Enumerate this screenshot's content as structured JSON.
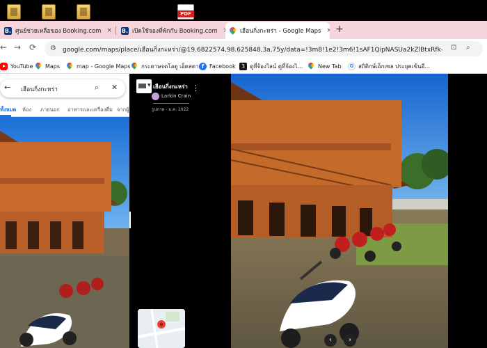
{
  "browser": {
    "tabs": [
      {
        "label": "ศูนย์ช่วยเหลือของ Booking.com",
        "favicon": "booking-icon",
        "active": false
      },
      {
        "label": "เปิดใช้จองที่พักกับ Booking.com",
        "favicon": "booking-icon",
        "active": false
      },
      {
        "label": "เฮือนกิ่งกะหร่า - Google Maps",
        "favicon": "google-maps-icon",
        "active": true
      }
    ],
    "new_tab": "+",
    "tab_close": "×",
    "url": "google.com/maps/place/เฮือนกิ่งกะหร่า/@19.6822574,98.625848,3a,75y/data=!3m8!1e2!3m6!1sAF1QipNASUa2kZlBtxRfk-QRSP3sxFptT3uc...",
    "bookmarks": [
      {
        "label": "YouTube",
        "icon": "youtube-icon"
      },
      {
        "label": "Maps",
        "icon": "maps-icon"
      },
      {
        "label": "map - Google Maps",
        "icon": "maps-icon"
      },
      {
        "label": "กระดาษจดโอตู เอ็ดสตา...",
        "icon": "maps-icon"
      },
      {
        "label": "Facebook",
        "icon": "facebook-icon"
      },
      {
        "label": "ดูที่จ้องไลน์ ดูที่จ้องไ...",
        "icon": "site-3-icon"
      },
      {
        "label": "New Tab",
        "icon": "maps-icon"
      },
      {
        "label": "สถิติกษ์เอ็กเซล ประยุคเข้นอี...",
        "icon": "google-icon"
      }
    ]
  },
  "maps": {
    "search_value": "เฮือนกิ่งกะหร่า",
    "photo_tabs": [
      "ทั้งหมด",
      "ห้อง",
      "ภายนอก",
      "อาหารและเครื่องดื่ม",
      "จากผู้เ"
    ],
    "viewer": {
      "place_title": "เฮือนกิ่งกะหร่า",
      "author": "Larkin Crain",
      "date": "รูปภาพ - ม.ค. 2022"
    }
  },
  "colors": {
    "tab_strip": "#f6d4dc",
    "accent": "#1a73e8",
    "booking_blue": "#003580"
  }
}
